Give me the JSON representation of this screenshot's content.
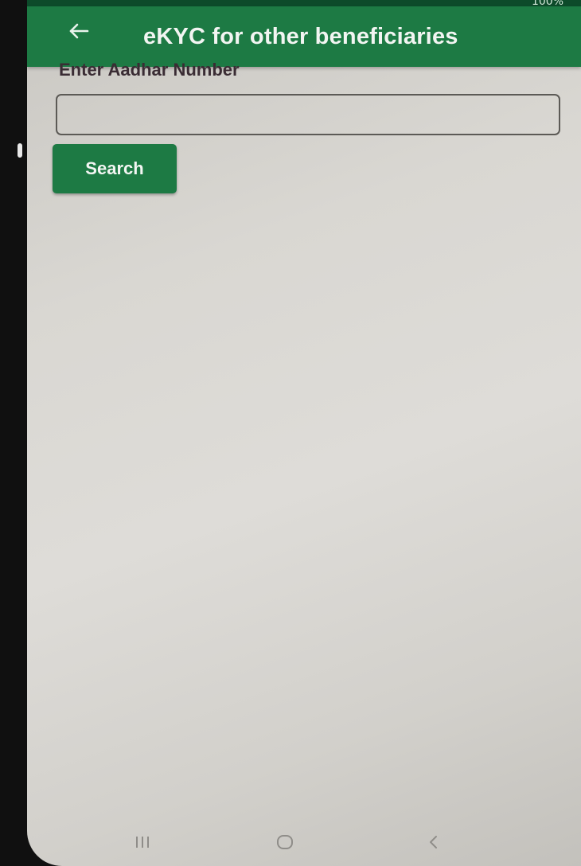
{
  "status_bar": {
    "battery_text": "100%"
  },
  "app_bar": {
    "back_icon": "arrow-left-icon",
    "title": "eKYC for other beneficiaries"
  },
  "form": {
    "aadhar_label": "Enter Aadhar Number",
    "aadhar_value": "",
    "aadhar_placeholder": "",
    "search_label": "Search"
  },
  "nav_bar": {
    "recent_icon": "recent-apps-icon",
    "home_icon": "home-icon",
    "back_icon": "back-chevron-icon"
  },
  "colors": {
    "primary": "#1d7a44",
    "status_bar": "#0d4a2a",
    "background": "#d9d7d2",
    "label_text": "#3a2c34"
  }
}
